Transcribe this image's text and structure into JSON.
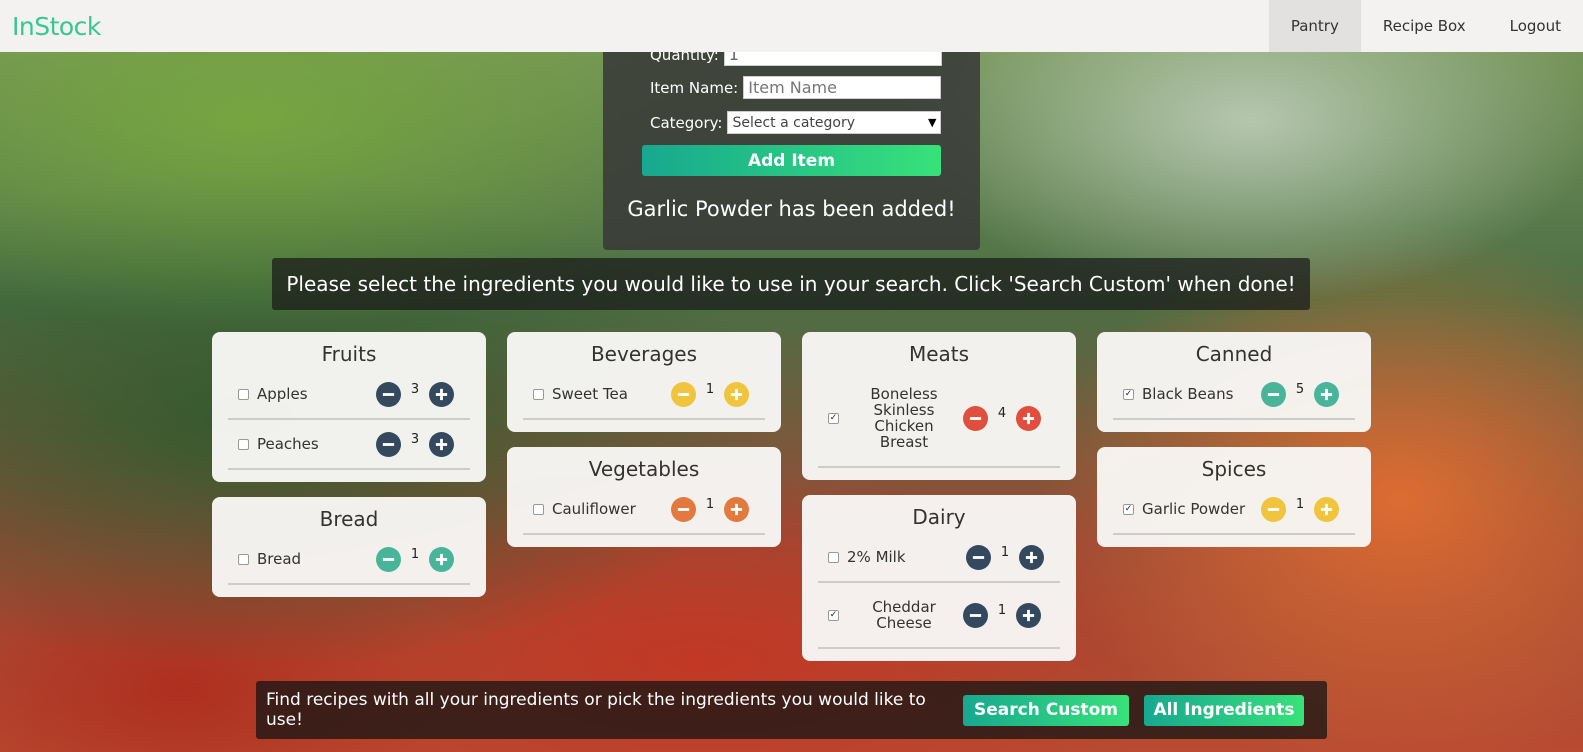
{
  "nav": {
    "brand": "InStock",
    "links": [
      "Pantry",
      "Recipe Box",
      "Logout"
    ]
  },
  "add_form": {
    "quantity_label": "Quantity:",
    "quantity_value": "1",
    "item_name_label": "Item Name:",
    "item_name_placeholder": "Item Name",
    "category_label": "Category:",
    "category_selected": "Select a category",
    "add_button": "Add Item",
    "status_message": "Garlic Powder has been added!"
  },
  "instruction": "Please select the ingredients you would like to use in your search. Click 'Search Custom' when done!",
  "categories": [
    {
      "title": "Fruits",
      "color": "#34495e",
      "items": [
        {
          "name": "Apples",
          "qty": "3",
          "checked": false
        },
        {
          "name": "Peaches",
          "qty": "3",
          "checked": false
        }
      ]
    },
    {
      "title": "Bread",
      "color": "#48b59a",
      "items": [
        {
          "name": "Bread",
          "qty": "1",
          "checked": false
        }
      ]
    },
    {
      "title": "Beverages",
      "color": "#f0c53d",
      "items": [
        {
          "name": "Sweet Tea",
          "qty": "1",
          "checked": false
        }
      ]
    },
    {
      "title": "Vegetables",
      "color": "#e27a3f",
      "items": [
        {
          "name": "Cauliflower",
          "qty": "1",
          "checked": false
        }
      ]
    },
    {
      "title": "Meats",
      "color": "#e04e3d",
      "items": [
        {
          "name": "Boneless Skinless Chicken Breast",
          "qty": "4",
          "checked": true
        }
      ]
    },
    {
      "title": "Dairy",
      "color": "#34495e",
      "items": [
        {
          "name": "2% Milk",
          "qty": "1",
          "checked": false
        },
        {
          "name": "Cheddar Cheese",
          "qty": "1",
          "checked": true
        }
      ]
    },
    {
      "title": "Canned",
      "color": "#48b59a",
      "items": [
        {
          "name": "Black Beans",
          "qty": "5",
          "checked": true
        }
      ]
    },
    {
      "title": "Spices",
      "color": "#f0c53d",
      "items": [
        {
          "name": "Garlic Powder",
          "qty": "1",
          "checked": true
        }
      ]
    }
  ],
  "search_bar": {
    "text": "Find recipes with all your ingredients or pick the ingredients you would like to use!",
    "search_custom": "Search Custom",
    "all_ingredients": "All Ingredients"
  }
}
